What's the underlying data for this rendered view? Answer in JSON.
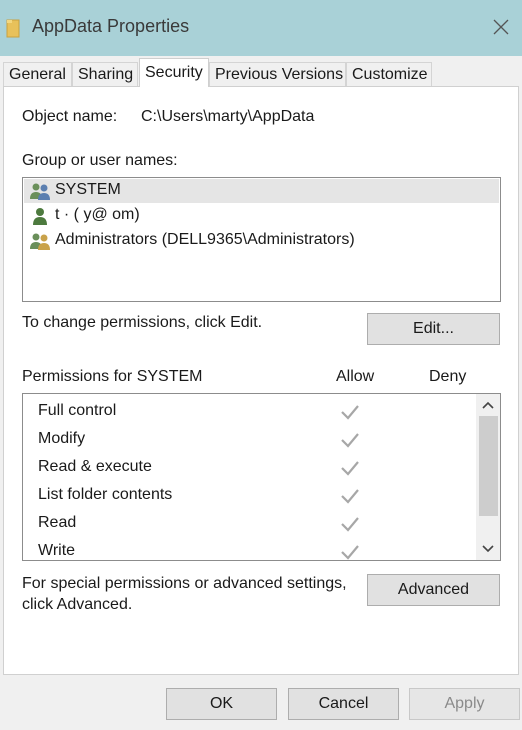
{
  "window": {
    "title": "AppData Properties",
    "accent_color": "#a9d1d7"
  },
  "tabs": [
    {
      "label": "General",
      "active": false
    },
    {
      "label": "Sharing",
      "active": false
    },
    {
      "label": "Security",
      "active": true
    },
    {
      "label": "Previous Versions",
      "active": false
    },
    {
      "label": "Customize",
      "active": false
    }
  ],
  "security": {
    "object_name_label": "Object name:",
    "object_name_value": "C:\\Users\\marty\\AppData",
    "group_label": "Group or user names:",
    "users": [
      {
        "name": "SYSTEM",
        "icon": "group-users-icon",
        "selected": true
      },
      {
        "name": "t          · (               y@        om)",
        "icon": "user-icon",
        "selected": false
      },
      {
        "name": "Administrators (DELL9365\\Administrators)",
        "icon": "group-users-icon",
        "selected": false
      }
    ],
    "change_permissions_text": "To change permissions, click Edit.",
    "edit_button": "Edit...",
    "permissions_label": "Permissions for SYSTEM",
    "allow_header": "Allow",
    "deny_header": "Deny",
    "permissions": [
      {
        "name": "Full control",
        "allow": true,
        "deny": false
      },
      {
        "name": "Modify",
        "allow": true,
        "deny": false
      },
      {
        "name": "Read & execute",
        "allow": true,
        "deny": false
      },
      {
        "name": "List folder contents",
        "allow": true,
        "deny": false
      },
      {
        "name": "Read",
        "allow": true,
        "deny": false
      },
      {
        "name": "Write",
        "allow": true,
        "deny": false
      }
    ],
    "advanced_text_line1": "For special permissions or advanced settings,",
    "advanced_text_line2": "click Advanced.",
    "advanced_button": "Advanced"
  },
  "footer": {
    "ok": "OK",
    "cancel": "Cancel",
    "apply": "Apply",
    "apply_disabled": true
  }
}
